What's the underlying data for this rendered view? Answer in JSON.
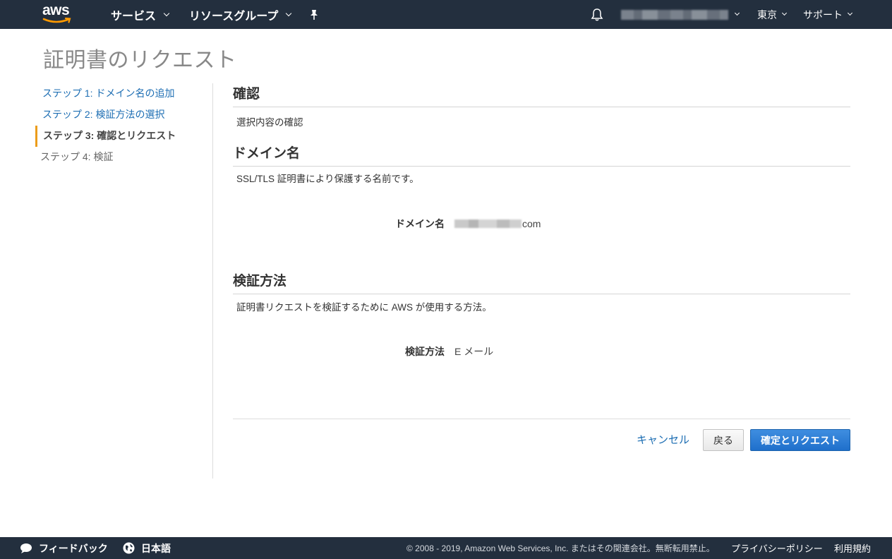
{
  "topnav": {
    "logo_text": "aws",
    "services_label": "サービス",
    "resource_groups_label": "リソースグループ",
    "region_label": "東京",
    "support_label": "サポート"
  },
  "page": {
    "title": "証明書のリクエスト"
  },
  "steps": [
    {
      "label": "ステップ 1: ドメイン名の追加",
      "state": "link"
    },
    {
      "label": "ステップ 2: 検証方法の選択",
      "state": "link"
    },
    {
      "label": "ステップ 3: 確認とリクエスト",
      "state": "current"
    },
    {
      "label": "ステップ 4: 検証",
      "state": "todo"
    }
  ],
  "review": {
    "heading": "確認",
    "description": "選択内容の確認"
  },
  "domain_section": {
    "heading": "ドメイン名",
    "description": "SSL/TLS 証明書により保護する名前です。",
    "field_label": "ドメイン名",
    "field_value_suffix": "com"
  },
  "validation_section": {
    "heading": "検証方法",
    "description": "証明書リクエストを検証するために AWS が使用する方法。",
    "field_label": "検証方法",
    "field_value": "E メール"
  },
  "actions": {
    "cancel_label": "キャンセル",
    "back_label": "戻る",
    "confirm_label": "確定とリクエスト"
  },
  "footer": {
    "feedback_label": "フィードバック",
    "language_label": "日本語",
    "copyright": "© 2008 - 2019, Amazon Web Services, Inc. またはその関連会社。無断転用禁止。",
    "privacy_label": "プライバシーポリシー",
    "terms_label": "利用規約"
  },
  "colors": {
    "nav_bg": "#232f3e",
    "link": "#1d6eb3",
    "step_accent": "#ec9d1b",
    "primary_button": "#2a7bd6"
  },
  "icons": [
    "aws-logo",
    "pin-icon",
    "bell-icon",
    "speech-bubble-icon",
    "globe-icon"
  ]
}
